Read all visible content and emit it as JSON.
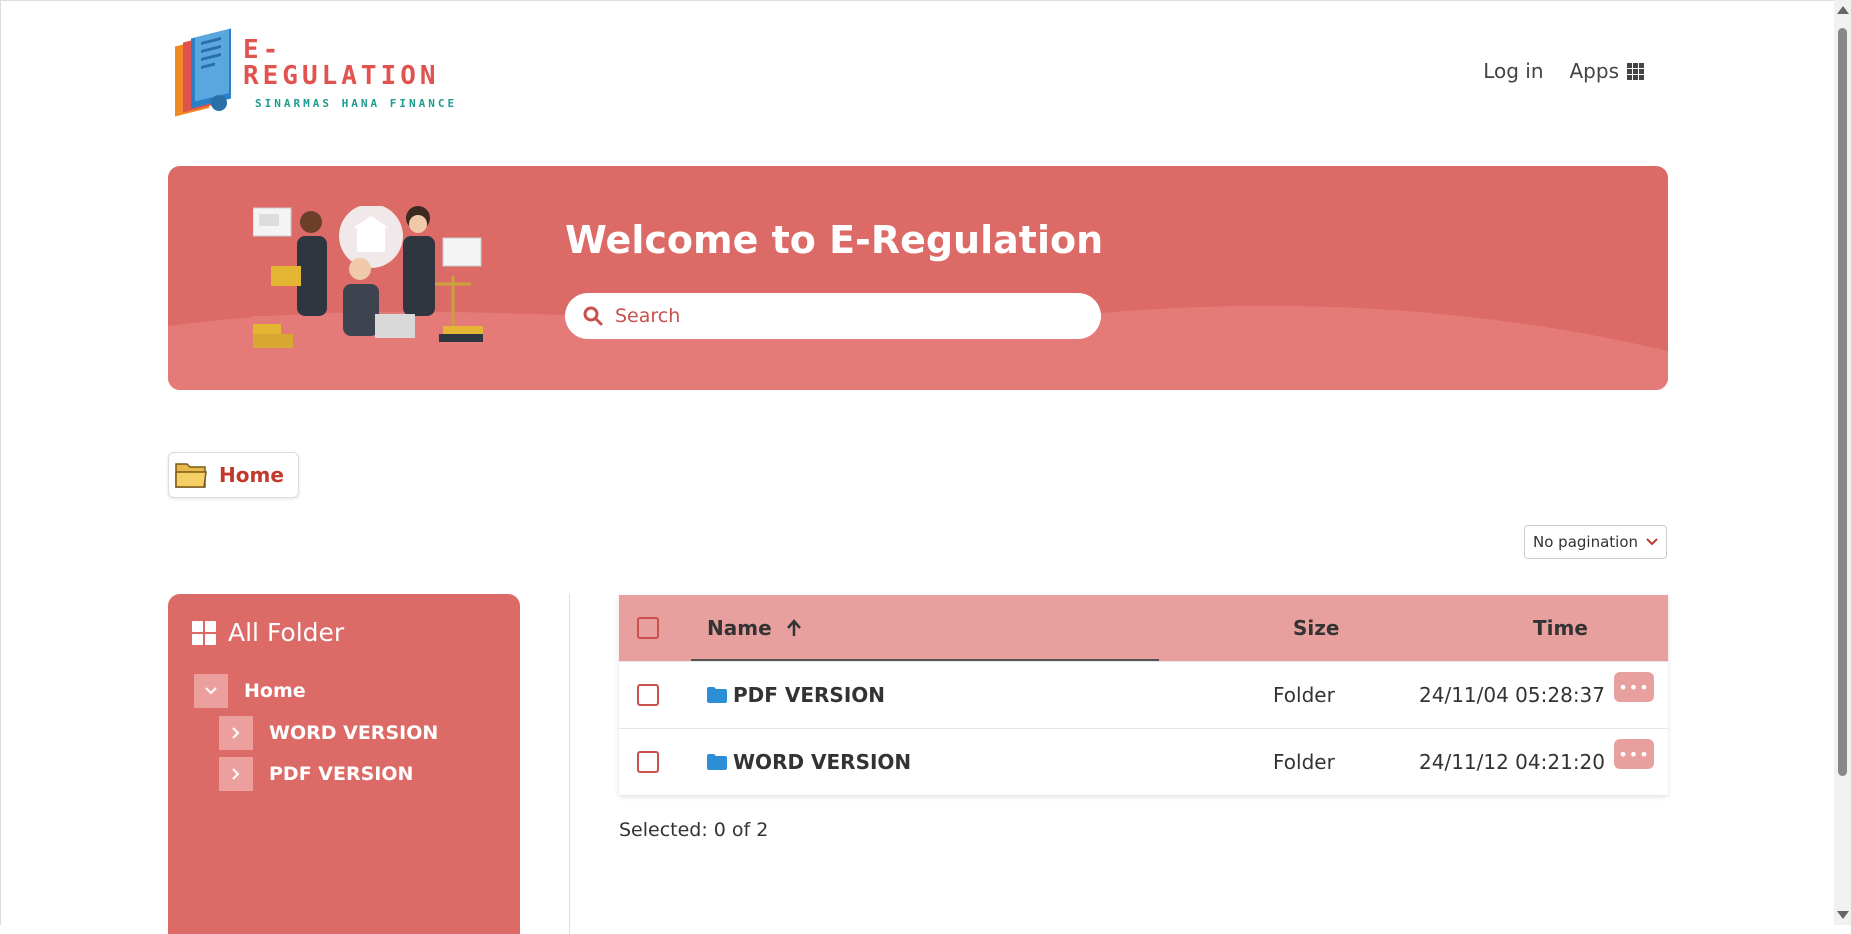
{
  "header": {
    "logo_title": "E-REGULATION",
    "logo_subtitle": "SINARMAS HANA FINANCE",
    "nav": {
      "login": "Log in",
      "apps": "Apps"
    }
  },
  "banner": {
    "title": "Welcome to E-Regulation",
    "search_placeholder": "Search"
  },
  "breadcrumb": {
    "label": "Home"
  },
  "pagination": {
    "selected": "No pagination"
  },
  "sidebar": {
    "title": "All Folder",
    "root": "Home",
    "children": [
      "WORD VERSION",
      "PDF VERSION"
    ]
  },
  "table": {
    "columns": {
      "name": "Name",
      "size": "Size",
      "time": "Time"
    },
    "rows": [
      {
        "name": "PDF VERSION",
        "size": "Folder",
        "time": "24/11/04 05:28:37"
      },
      {
        "name": "WORD VERSION",
        "size": "Folder",
        "time": "24/11/12 04:21:20"
      }
    ],
    "selected_text": "Selected: 0 of 2"
  },
  "colors": {
    "brand": "#dc6a67",
    "header_row": "#e8a09f",
    "accent_text": "#c0392b",
    "folder_icon": "#2b8ed6"
  }
}
